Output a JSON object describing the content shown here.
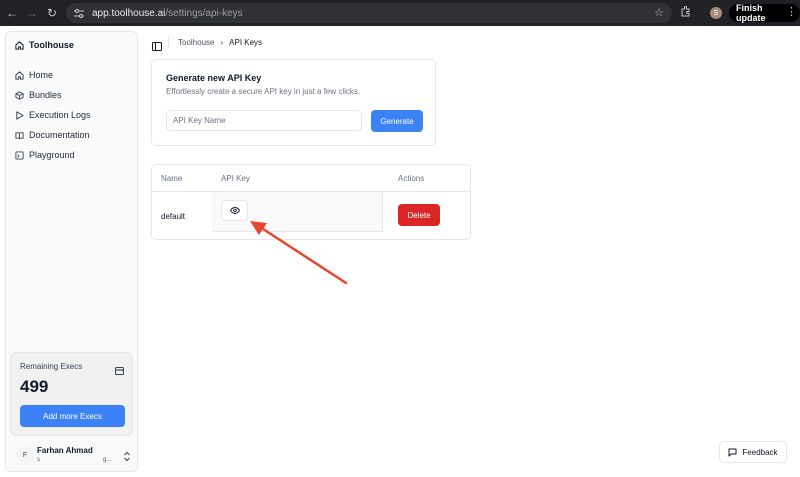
{
  "browser": {
    "url_host": "app.toolhouse.ai",
    "url_path": "/settings/api-keys",
    "profile_initial": "S",
    "finish_update_label": "Finish update"
  },
  "sidebar": {
    "brand": "Toolhouse",
    "items": [
      {
        "label": "Home",
        "icon": "home-icon"
      },
      {
        "label": "Bundles",
        "icon": "box-icon"
      },
      {
        "label": "Execution Logs",
        "icon": "play-icon"
      },
      {
        "label": "Documentation",
        "icon": "book-icon"
      },
      {
        "label": "Playground",
        "icon": "terminal-icon"
      }
    ],
    "execs": {
      "title": "Remaining Execs",
      "count": "499",
      "button_label": "Add more Execs"
    },
    "user": {
      "initial": "F",
      "name": "Farhan Ahmad",
      "email_start": "s",
      "email_end": "g..."
    }
  },
  "header": {
    "breadcrumb_root": "Toolhouse",
    "breadcrumb_separator": "›",
    "breadcrumb_current": "API Keys"
  },
  "generate": {
    "title": "Generate new API Key",
    "description": "Effortlessly create a secure API key in just a few clicks.",
    "input_placeholder": "API Key Name",
    "button_label": "Generate"
  },
  "table": {
    "columns": [
      "Name",
      "API Key",
      "Actions"
    ],
    "rows": [
      {
        "name": "default",
        "action_label": "Delete"
      }
    ]
  },
  "feedback_label": "Feedback",
  "colors": {
    "accent": "#3b82f6",
    "danger": "#dc2626",
    "annotation": "#e8452c"
  }
}
